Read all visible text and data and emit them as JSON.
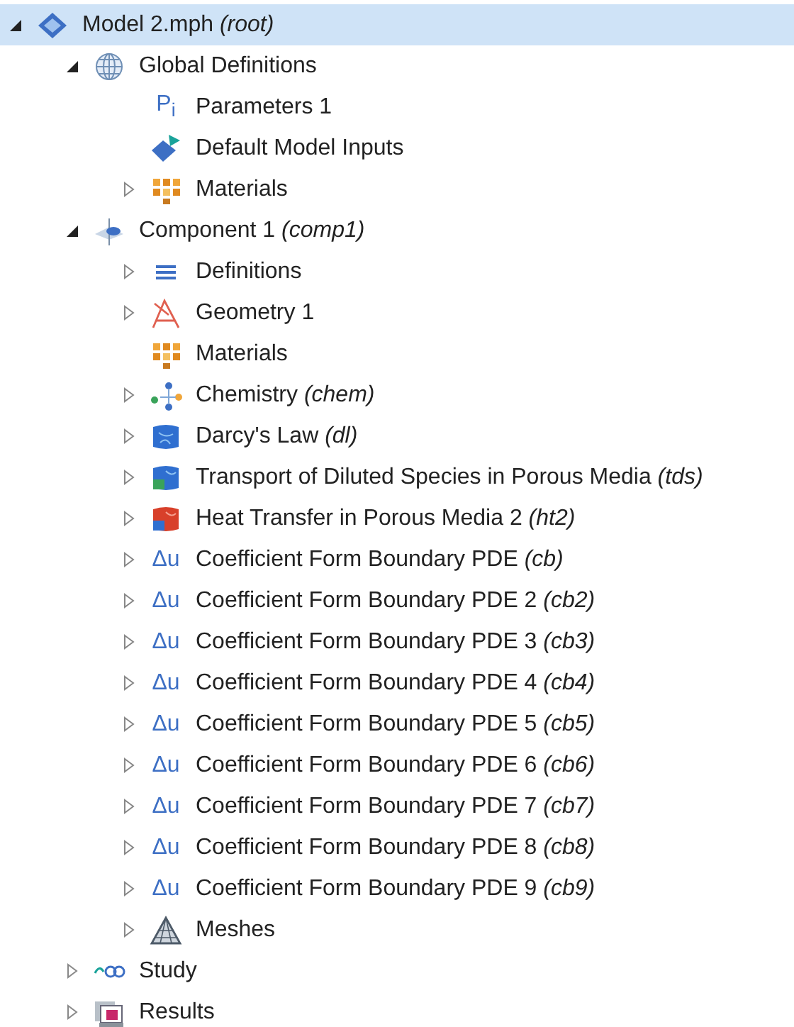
{
  "tree": [
    {
      "label": "Model 2.mph  *(root)*",
      "kind": "model",
      "expanded": true,
      "selected": true,
      "children": [
        {
          "label": "Global Definitions",
          "kind": "globe",
          "expanded": true,
          "selected": false,
          "children": [
            {
              "label": "Parameters 1",
              "kind": "glyph",
              "glyph": "P$_{i}$",
              "selected": false
            },
            {
              "label": "Default Model Inputs",
              "kind": "inputs",
              "selected": false
            },
            {
              "label": "Materials",
              "kind": "materials",
              "expanded": false,
              "selected": false
            }
          ]
        },
        {
          "label": "Component 1  *(comp1)*",
          "kind": "component",
          "expanded": true,
          "selected": false,
          "children": [
            {
              "label": "Definitions",
              "kind": "definitions",
              "expanded": false,
              "selected": false
            },
            {
              "label": "Geometry 1",
              "kind": "geometry",
              "expanded": false,
              "selected": false
            },
            {
              "label": "Materials",
              "kind": "materials",
              "selected": false
            },
            {
              "label": "Chemistry  *(chem)*",
              "kind": "chemistry",
              "expanded": false,
              "selected": false
            },
            {
              "label": "Darcy's Law  *(dl)*",
              "kind": "darcy",
              "expanded": false,
              "selected": false
            },
            {
              "label": "Transport of Diluted Species in Porous Media  *(tds)*",
              "kind": "transport",
              "expanded": false,
              "selected": false
            },
            {
              "label": "Heat Transfer in Porous Media 2  *(ht2)*",
              "kind": "heat",
              "expanded": false,
              "selected": false
            },
            {
              "label": "Coefficient Form Boundary PDE  *(cb)*",
              "kind": "glyph",
              "glyph": "Δu",
              "expanded": false,
              "selected": false
            },
            {
              "label": "Coefficient Form Boundary PDE 2  *(cb2)*",
              "kind": "glyph",
              "glyph": "Δu",
              "expanded": false,
              "selected": false
            },
            {
              "label": "Coefficient Form Boundary PDE 3  *(cb3)*",
              "kind": "glyph",
              "glyph": "Δu",
              "expanded": false,
              "selected": false
            },
            {
              "label": "Coefficient Form Boundary PDE 4  *(cb4)*",
              "kind": "glyph",
              "glyph": "Δu",
              "expanded": false,
              "selected": false
            },
            {
              "label": "Coefficient Form Boundary PDE 5  *(cb5)*",
              "kind": "glyph",
              "glyph": "Δu",
              "expanded": false,
              "selected": false
            },
            {
              "label": "Coefficient Form Boundary PDE 6  *(cb6)*",
              "kind": "glyph",
              "glyph": "Δu",
              "expanded": false,
              "selected": false
            },
            {
              "label": "Coefficient Form Boundary PDE 7  *(cb7)*",
              "kind": "glyph",
              "glyph": "Δu",
              "expanded": false,
              "selected": false
            },
            {
              "label": "Coefficient Form Boundary PDE 8  *(cb8)*",
              "kind": "glyph",
              "glyph": "Δu",
              "expanded": false,
              "selected": false
            },
            {
              "label": "Coefficient Form Boundary PDE 9  *(cb9)*",
              "kind": "glyph",
              "glyph": "Δu",
              "expanded": false,
              "selected": false
            },
            {
              "label": "Meshes",
              "kind": "meshes",
              "expanded": false,
              "selected": false
            }
          ]
        },
        {
          "label": "Study",
          "kind": "study",
          "expanded": false,
          "selected": false
        },
        {
          "label": "Results",
          "kind": "results",
          "expanded": false,
          "selected": false
        }
      ]
    }
  ]
}
